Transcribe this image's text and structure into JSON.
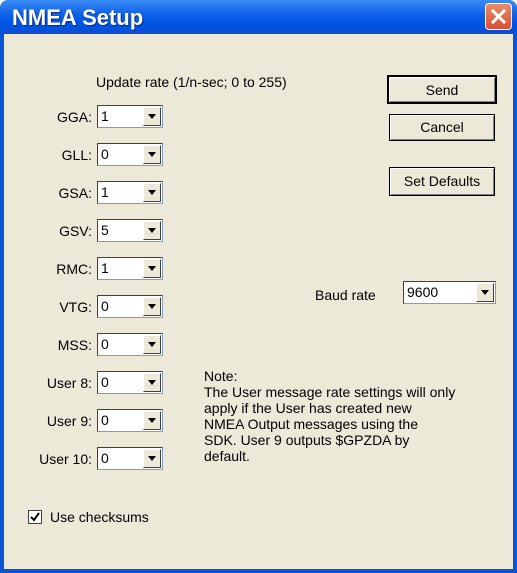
{
  "window": {
    "title": "NMEA Setup"
  },
  "update_rate_header": "Update rate (1/n-sec; 0 to 255)",
  "rates": [
    {
      "label": "GGA:",
      "value": "1"
    },
    {
      "label": "GLL:",
      "value": "0"
    },
    {
      "label": "GSA:",
      "value": "1"
    },
    {
      "label": "GSV:",
      "value": "5"
    },
    {
      "label": "RMC:",
      "value": "1"
    },
    {
      "label": "VTG:",
      "value": "0"
    },
    {
      "label": "MSS:",
      "value": "0"
    },
    {
      "label": "User 8:",
      "value": "0"
    },
    {
      "label": "User 9:",
      "value": "0"
    },
    {
      "label": "User 10:",
      "value": "0"
    }
  ],
  "buttons": {
    "send": "Send",
    "cancel": "Cancel",
    "set_defaults": "Set Defaults"
  },
  "baud": {
    "label": "Baud rate",
    "value": "9600"
  },
  "note": {
    "heading": "Note:",
    "lines": [
      "The User message rate settings will only",
      "apply if the User has created new",
      "NMEA Output messages using the",
      "SDK.  User 9 outputs $GPZDA by",
      "default."
    ]
  },
  "checksums": {
    "label": "Use checksums",
    "checked": true
  }
}
